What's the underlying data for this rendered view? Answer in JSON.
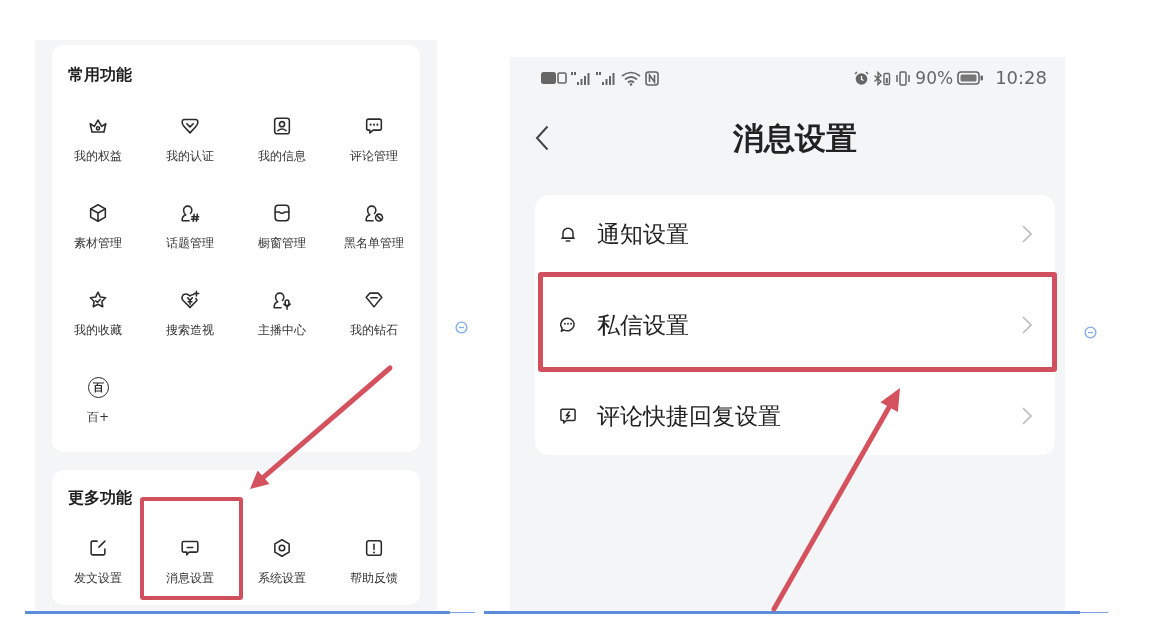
{
  "left_screen": {
    "common_functions": {
      "title": "常用功能",
      "items": [
        {
          "label": "我的权益",
          "highlighted": false
        },
        {
          "label": "我的认证",
          "highlighted": false
        },
        {
          "label": "我的信息",
          "highlighted": false
        },
        {
          "label": "评论管理",
          "highlighted": false
        },
        {
          "label": "素材管理",
          "highlighted": false
        },
        {
          "label": "话题管理",
          "highlighted": false
        },
        {
          "label": "橱窗管理",
          "highlighted": false
        },
        {
          "label": "黑名单管理",
          "highlighted": false
        },
        {
          "label": "我的收藏",
          "highlighted": false
        },
        {
          "label": "搜索造视",
          "highlighted": false
        },
        {
          "label": "主播中心",
          "highlighted": false
        },
        {
          "label": "我的钻石",
          "highlighted": false
        },
        {
          "label": "百+",
          "glyph": "百",
          "highlighted": false
        }
      ]
    },
    "more_functions": {
      "title": "更多功能",
      "items": [
        {
          "label": "发文设置",
          "highlighted": false
        },
        {
          "label": "消息设置",
          "highlighted": true
        },
        {
          "label": "系统设置",
          "highlighted": false
        },
        {
          "label": "帮助反馈",
          "highlighted": false
        }
      ]
    }
  },
  "right_screen": {
    "status_bar": {
      "battery": "90%",
      "time": "10:28"
    },
    "header": {
      "title": "消息设置"
    },
    "settings": [
      {
        "label": "通知设置",
        "highlighted": false
      },
      {
        "label": "私信设置",
        "highlighted": true
      },
      {
        "label": "评论快捷回复设置",
        "highlighted": false
      }
    ]
  }
}
